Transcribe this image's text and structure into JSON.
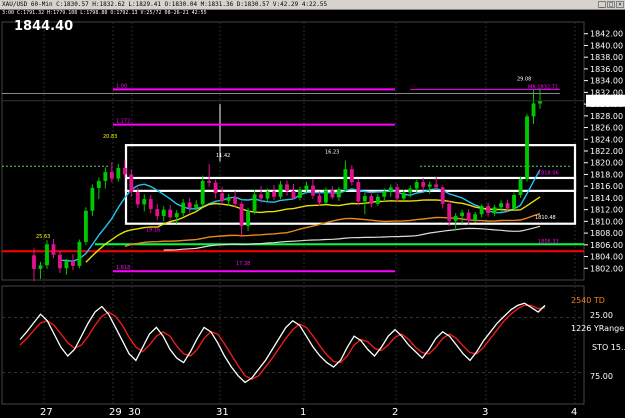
{
  "window": {
    "title": "XAU/USD 60-Min  C:1830.57  H:1832.62  L:1829.41  O:1830.04  M:1831.36  D:1830.57  V:42.29  4:22.55",
    "buttons": [
      "_",
      "□",
      "×"
    ]
  },
  "info_line": "3:00  C:1791.32  H:1779.108  L:1798.88  O:1792.13  V:25/72  08-26-21  42:55",
  "big_price": "1844.40",
  "colors": {
    "background": "#000000",
    "up_candle": "#00c800",
    "down_candle": "#e1128c",
    "magenta_level": "#ff00ff",
    "box": "#ffffff",
    "green_hline": "#00ff3c",
    "red_hline": "#ff0000",
    "ma_cyan": "#22c6f0",
    "ma_yellow": "#e8e000",
    "ma_orange": "#e88a18",
    "ma_white": "#dddddd",
    "stoch_k": "#ffffff",
    "stoch_d": "#ff1a1a",
    "current_price_bg": "#ffffff",
    "current_price_fg": "#000000"
  },
  "chart_data": [
    {
      "type": "candlestick",
      "title": "XAU/USD 60-Min",
      "ylim": [
        1800,
        1844
      ],
      "y_ticks": [
        "1842.00",
        "1840.00",
        "1838.00",
        "1836.00",
        "1834.00",
        "1832.00",
        "1830.00",
        "1828.00",
        "1826.00",
        "1824.00",
        "1822.00",
        "1820.00",
        "1818.00",
        "1816.00",
        "1814.00",
        "1812.00",
        "1810.00",
        "1808.00",
        "1806.00",
        "1804.00",
        "1802.00"
      ],
      "current_price": "1830.57",
      "x_tick_labels": [
        "27",
        "29",
        "30",
        "31",
        "1",
        "2",
        "3",
        "4"
      ],
      "levels": [
        {
          "label": "1.00",
          "value": 1832.5,
          "color": "#ff00ff"
        },
        {
          "label": "1.272",
          "value": 1826.5,
          "color": "#ff00ff"
        },
        {
          "label": "1.618",
          "value": 1801.5,
          "color": "#ff00ff"
        }
      ],
      "annotations": [
        "11.42",
        "16.23",
        "29.08",
        "MR 1832.71",
        "19.16",
        "1818.06",
        "25.63",
        "20.83",
        "1810.48",
        "1806.33",
        "17.38"
      ],
      "box_bands": [
        {
          "top": 1823.0,
          "bottom": 1809.6
        },
        {
          "top": 1817.4,
          "bottom": 1815.2
        }
      ],
      "candles": [
        [
          1804.2,
          1805.4,
          1799.8,
          1801.9
        ],
        [
          1801.9,
          1803.1,
          1800.2,
          1802.5
        ],
        [
          1802.5,
          1806.8,
          1801.9,
          1806.1
        ],
        [
          1806.1,
          1807.0,
          1803.7,
          1804.3
        ],
        [
          1804.3,
          1805.0,
          1801.2,
          1802.0
        ],
        [
          1802.0,
          1803.6,
          1800.9,
          1803.2
        ],
        [
          1803.2,
          1804.4,
          1801.7,
          1802.4
        ],
        [
          1802.4,
          1806.9,
          1802.0,
          1806.5
        ],
        [
          1806.5,
          1812.4,
          1806.0,
          1811.8
        ],
        [
          1811.8,
          1816.3,
          1810.9,
          1815.7
        ],
        [
          1815.7,
          1817.5,
          1813.8,
          1816.9
        ],
        [
          1816.9,
          1819.2,
          1815.6,
          1818.4
        ],
        [
          1818.4,
          1820.1,
          1816.7,
          1817.3
        ],
        [
          1817.3,
          1819.8,
          1816.8,
          1819.1
        ],
        [
          1819.1,
          1820.5,
          1817.4,
          1818.0
        ],
        [
          1818.0,
          1818.9,
          1814.2,
          1815.0
        ],
        [
          1815.0,
          1815.8,
          1812.3,
          1812.9
        ],
        [
          1812.9,
          1814.6,
          1811.7,
          1813.8
        ],
        [
          1813.8,
          1814.5,
          1811.4,
          1812.1
        ],
        [
          1812.1,
          1813.0,
          1810.2,
          1810.9
        ],
        [
          1810.9,
          1812.6,
          1810.0,
          1812.0
        ],
        [
          1812.0,
          1812.8,
          1810.3,
          1810.7
        ],
        [
          1810.7,
          1811.9,
          1809.6,
          1811.4
        ],
        [
          1811.4,
          1813.8,
          1810.9,
          1813.2
        ],
        [
          1813.2,
          1814.0,
          1811.5,
          1812.3
        ],
        [
          1812.3,
          1813.6,
          1811.7,
          1812.9
        ],
        [
          1812.9,
          1817.8,
          1812.5,
          1816.9
        ],
        [
          1816.9,
          1819.8,
          1815.9,
          1816.6
        ],
        [
          1816.6,
          1817.1,
          1813.9,
          1814.8
        ],
        [
          1814.8,
          1815.9,
          1812.9,
          1813.5
        ],
        [
          1813.5,
          1814.7,
          1812.6,
          1814.1
        ],
        [
          1814.1,
          1815.2,
          1812.4,
          1813.0
        ],
        [
          1813.0,
          1813.4,
          1807.3,
          1809.2
        ],
        [
          1809.2,
          1812.3,
          1808.4,
          1811.8
        ],
        [
          1811.8,
          1815.4,
          1811.2,
          1814.6
        ],
        [
          1814.6,
          1816.0,
          1813.2,
          1813.9
        ],
        [
          1813.9,
          1815.6,
          1813.3,
          1815.1
        ],
        [
          1815.1,
          1816.2,
          1813.6,
          1814.2
        ],
        [
          1814.2,
          1816.9,
          1813.8,
          1816.3
        ],
        [
          1816.3,
          1817.0,
          1814.4,
          1815.2
        ],
        [
          1815.2,
          1816.4,
          1813.7,
          1814.0
        ],
        [
          1814.0,
          1815.9,
          1813.6,
          1815.4
        ],
        [
          1815.4,
          1816.8,
          1814.7,
          1816.1
        ],
        [
          1816.1,
          1817.2,
          1813.8,
          1814.4
        ],
        [
          1814.4,
          1815.1,
          1812.6,
          1813.2
        ],
        [
          1813.2,
          1815.8,
          1812.9,
          1815.3
        ],
        [
          1815.3,
          1816.0,
          1813.8,
          1814.1
        ],
        [
          1814.1,
          1815.9,
          1813.5,
          1815.5
        ],
        [
          1815.5,
          1820.4,
          1815.0,
          1818.9
        ],
        [
          1818.9,
          1819.6,
          1816.1,
          1816.7
        ],
        [
          1816.7,
          1817.2,
          1812.7,
          1813.4
        ],
        [
          1813.4,
          1814.9,
          1811.2,
          1814.3
        ],
        [
          1814.3,
          1815.1,
          1812.4,
          1813.0
        ],
        [
          1813.0,
          1814.7,
          1812.6,
          1814.2
        ],
        [
          1814.2,
          1815.6,
          1813.3,
          1815.1
        ],
        [
          1815.1,
          1816.3,
          1814.2,
          1815.8
        ],
        [
          1815.8,
          1816.4,
          1813.4,
          1813.9
        ],
        [
          1813.9,
          1815.4,
          1813.5,
          1814.9
        ],
        [
          1814.9,
          1816.1,
          1814.1,
          1815.6
        ],
        [
          1815.6,
          1817.1,
          1814.9,
          1816.7
        ],
        [
          1816.7,
          1817.4,
          1815.2,
          1815.9
        ],
        [
          1815.9,
          1816.8,
          1814.7,
          1816.3
        ],
        [
          1816.3,
          1817.6,
          1815.4,
          1815.8
        ],
        [
          1815.8,
          1816.1,
          1812.2,
          1813.0
        ],
        [
          1813.0,
          1813.6,
          1809.2,
          1810.1
        ],
        [
          1810.1,
          1811.4,
          1808.4,
          1810.9
        ],
        [
          1810.9,
          1812.0,
          1809.6,
          1811.5
        ],
        [
          1811.5,
          1812.1,
          1809.4,
          1810.2
        ],
        [
          1810.2,
          1811.6,
          1809.8,
          1811.2
        ],
        [
          1811.2,
          1812.9,
          1810.7,
          1812.6
        ],
        [
          1812.6,
          1813.2,
          1810.8,
          1811.4
        ],
        [
          1811.4,
          1812.8,
          1810.9,
          1812.4
        ],
        [
          1812.4,
          1813.6,
          1811.6,
          1813.1
        ],
        [
          1813.1,
          1813.7,
          1811.7,
          1812.2
        ],
        [
          1812.2,
          1814.9,
          1811.8,
          1814.5
        ],
        [
          1814.5,
          1817.6,
          1814.0,
          1817.2
        ],
        [
          1817.2,
          1828.3,
          1816.8,
          1827.9
        ],
        [
          1827.9,
          1832.4,
          1826.6,
          1830.1
        ],
        [
          1830.1,
          1832.6,
          1829.2,
          1830.57
        ]
      ]
    },
    {
      "type": "line",
      "title": "Stochastic oscillator",
      "ylim": [
        0,
        100
      ],
      "labels": [
        "2540 TD",
        "25.00",
        "1226 YRange",
        "STO 15...",
        "75.00"
      ],
      "series": [
        {
          "name": "%K",
          "color": "#ffffff",
          "values": [
            55,
            62,
            70,
            78,
            72,
            60,
            48,
            40,
            46,
            58,
            70,
            80,
            85,
            78,
            66,
            54,
            42,
            36,
            48,
            60,
            66,
            58,
            46,
            38,
            34,
            44,
            56,
            66,
            62,
            52,
            40,
            30,
            22,
            16,
            20,
            28,
            36,
            46,
            56,
            66,
            72,
            68,
            58,
            48,
            40,
            34,
            30,
            36,
            48,
            58,
            54,
            46,
            40,
            48,
            58,
            64,
            58,
            50,
            44,
            38,
            46,
            56,
            62,
            58,
            50,
            42,
            36,
            44,
            54,
            62,
            70,
            76,
            82,
            86,
            88,
            84,
            80,
            86
          ]
        },
        {
          "name": "%D",
          "color": "#ff1a1a",
          "values": [
            50,
            56,
            63,
            70,
            72,
            68,
            60,
            52,
            47,
            50,
            58,
            68,
            76,
            80,
            76,
            68,
            57,
            48,
            44,
            50,
            58,
            62,
            58,
            49,
            42,
            40,
            46,
            56,
            62,
            60,
            51,
            41,
            31,
            22,
            19,
            22,
            30,
            38,
            47,
            56,
            64,
            69,
            66,
            58,
            49,
            41,
            35,
            34,
            40,
            50,
            55,
            53,
            47,
            45,
            50,
            57,
            60,
            55,
            48,
            43,
            42,
            48,
            56,
            60,
            56,
            49,
            43,
            42,
            48,
            56,
            64,
            72,
            78,
            83,
            86,
            86,
            83,
            84
          ]
        }
      ],
      "x_tick_labels": [
        "27",
        "29",
        "30",
        "31",
        "1",
        "2",
        "3",
        "4"
      ]
    }
  ]
}
